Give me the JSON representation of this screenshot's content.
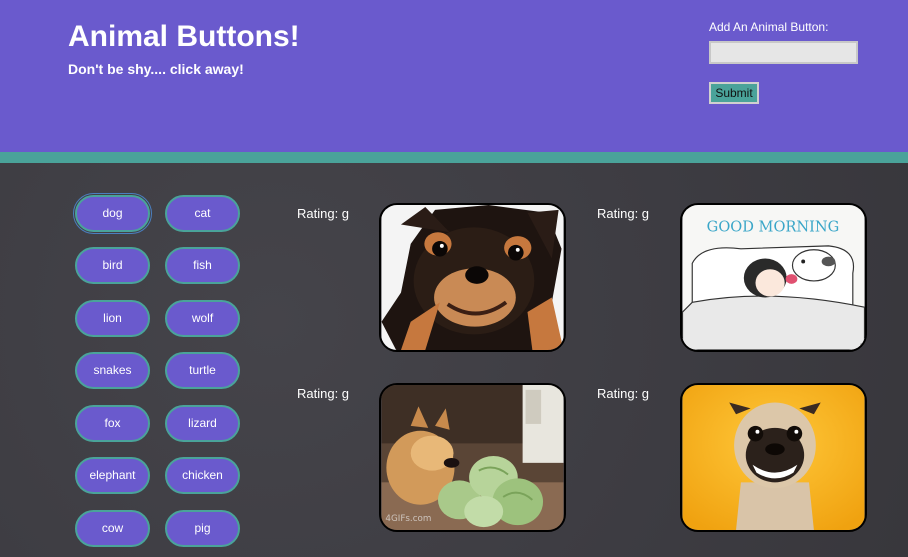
{
  "header": {
    "title": "Animal Buttons!",
    "subtitle": "Don't be shy.... click away!",
    "add_label": "Add An Animal Button:",
    "input_value": "",
    "submit_label": "Submit"
  },
  "animals": [
    "dog",
    "cat",
    "bird",
    "fish",
    "lion",
    "wolf",
    "snakes",
    "turtle",
    "fox",
    "lizard",
    "elephant",
    "chicken",
    "cow",
    "pig"
  ],
  "gifs": [
    {
      "rating": "Rating: g",
      "subject": "chihuahua-smiling"
    },
    {
      "rating": "Rating: g",
      "subject": "good-morning-dog-cartoon",
      "caption": "GOOD MORNING"
    },
    {
      "rating": "Rating: g",
      "subject": "dog-with-cabbages",
      "watermark": "4GIFs.com"
    },
    {
      "rating": "Rating: g",
      "subject": "pug-smiling"
    }
  ],
  "colors": {
    "header_bg": "#6a5acd",
    "accent": "#4aa39a",
    "body_bg": "#3d3c42"
  }
}
